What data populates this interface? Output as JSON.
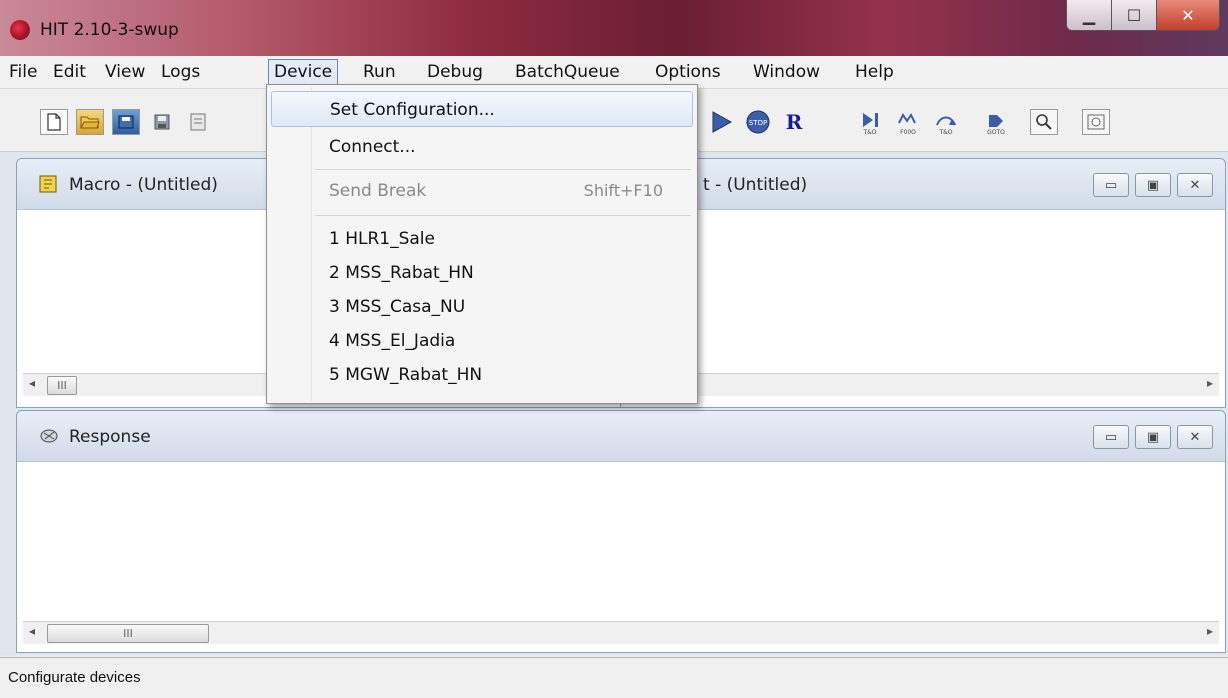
{
  "window": {
    "title": "HIT 2.10-3-swup",
    "min_glyph": "▁",
    "max_glyph": "☐",
    "close_glyph": "✕"
  },
  "menubar": {
    "items": [
      "File",
      "Edit",
      "View",
      "Logs",
      "Device",
      "Run",
      "Debug",
      "BatchQueue",
      "Options",
      "Window",
      "Help"
    ],
    "active": "Device"
  },
  "device_menu": {
    "set_configuration": "Set Configuration...",
    "connect": "Connect...",
    "send_break": "Send Break",
    "send_break_shortcut": "Shift+F10",
    "recent": [
      "1 HLR1_Sale",
      "2 MSS_Rabat_HN",
      "3 MSS_Casa_NU",
      "4 MSS_El_Jadia",
      "5 MGW_Rabat_HN"
    ]
  },
  "panels": {
    "macro_title": "Macro - (Untitled)",
    "partial_title": "t - (Untitled)",
    "response_title": "Response",
    "scroll_thumb": "III"
  },
  "toolbar": {
    "r_label": "R",
    "mini_labels": [
      "T&O",
      "F00O",
      "T&O",
      "GOTO"
    ]
  },
  "status": {
    "text": "Configurate devices"
  },
  "colors": {
    "accent": "#6a86b5",
    "menu_highlight": "#dfe9f7",
    "panel_header": "#d1dbe8"
  }
}
